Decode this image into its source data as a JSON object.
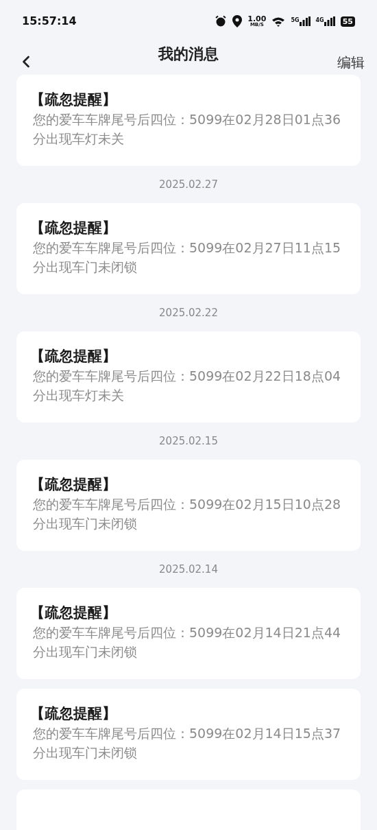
{
  "status_bar": {
    "time": "15:57:14",
    "speed": "1.00",
    "speed_unit": "MB/S",
    "signal_1": "5G",
    "signal_2": "4G",
    "battery": "55"
  },
  "header": {
    "title": "我的消息",
    "action": "编辑"
  },
  "feed": [
    {
      "kind": "message",
      "title": "【疏忽提醒】",
      "body": "您的爱车车牌尾号后四位：5099在02月28日01点36分出现车灯未关"
    },
    {
      "kind": "date",
      "text": "2025.02.27"
    },
    {
      "kind": "message",
      "title": "【疏忽提醒】",
      "body": "您的爱车车牌尾号后四位：5099在02月27日11点15分出现车门未闭锁"
    },
    {
      "kind": "date",
      "text": "2025.02.22"
    },
    {
      "kind": "message",
      "title": "【疏忽提醒】",
      "body": "您的爱车车牌尾号后四位：5099在02月22日18点04分出现车灯未关"
    },
    {
      "kind": "date",
      "text": "2025.02.15"
    },
    {
      "kind": "message",
      "title": "【疏忽提醒】",
      "body": "您的爱车车牌尾号后四位：5099在02月15日10点28分出现车门未闭锁"
    },
    {
      "kind": "date",
      "text": "2025.02.14"
    },
    {
      "kind": "message",
      "title": "【疏忽提醒】",
      "body": "您的爱车车牌尾号后四位：5099在02月14日21点44分出现车门未闭锁"
    },
    {
      "kind": "message",
      "title": "【疏忽提醒】",
      "body": "您的爱车车牌尾号后四位：5099在02月14日15点37分出现车门未闭锁"
    }
  ]
}
